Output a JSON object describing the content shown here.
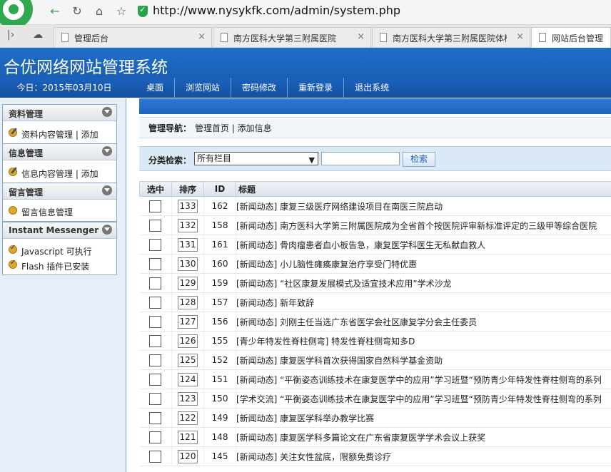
{
  "browser": {
    "url": "http://www.nysykfk.com/admin/system.php",
    "tabs": [
      {
        "label": "管理后台",
        "active": false
      },
      {
        "label": "南方医科大学第三附属医院",
        "active": false
      },
      {
        "label": "南方医科大学第三附属医院体检",
        "active": false
      },
      {
        "label": "网站后台管理",
        "active": true
      }
    ]
  },
  "app": {
    "title": "合优网络网站管理系统",
    "date": "今日：2015年03月10日",
    "menu": [
      "桌面",
      "浏览网站",
      "密码修改",
      "重新登录",
      "退出系统"
    ]
  },
  "sidebar": {
    "panels": [
      {
        "title": "资料管理",
        "items": [
          {
            "label": "资料内容管理 | 添加",
            "icon": "pencil-icon"
          }
        ]
      },
      {
        "title": "信息管理",
        "items": [
          {
            "label": "信息内容管理 | 添加",
            "icon": "pencil-icon"
          }
        ]
      },
      {
        "title": "留言管理",
        "items": [
          {
            "label": "留言信息管理",
            "icon": "message-icon"
          }
        ]
      },
      {
        "title": "Instant Messenger",
        "items": [
          {
            "label": "Javascript 可执行",
            "icon": "check-icon"
          },
          {
            "label": "Flash 插件已安装",
            "icon": "check-icon"
          }
        ]
      }
    ]
  },
  "main": {
    "crumb_label": "管理导航：",
    "crumb_text": "管理首页 | 添加信息",
    "filter_label": "分类检索：",
    "filter_select": "所有栏目",
    "search_button": "检索",
    "columns": [
      "选中",
      "排序",
      "ID",
      "标题"
    ],
    "rows": [
      {
        "order": "133",
        "id": "162",
        "title": "[新闻动态] 康复三级医疗网络建设项目在南医三院启动"
      },
      {
        "order": "132",
        "id": "158",
        "title": "[新闻动态] 南方医科大学第三附属医院成为全省首个按医院评审新标准评定的三级甲等综合医院"
      },
      {
        "order": "131",
        "id": "161",
        "title": "[新闻动态] 骨肉瘤患者血小板告急，康复医学科医生无私献血救人"
      },
      {
        "order": "130",
        "id": "160",
        "title": "[新闻动态] 小儿脑性瘫痪康复治疗享受门特优惠"
      },
      {
        "order": "129",
        "id": "159",
        "title": "[新闻动态] “社区康复发展模式及适宜技术应用”学术沙龙"
      },
      {
        "order": "128",
        "id": "157",
        "title": "[新闻动态] 新年致辞"
      },
      {
        "order": "127",
        "id": "156",
        "title": "[新闻动态] 刘刚主任当选广东省医学会社区康复学分会主任委员"
      },
      {
        "order": "126",
        "id": "155",
        "title": "[青少年特发性脊柱侧弯] 特发性脊柱侧弯知多D"
      },
      {
        "order": "125",
        "id": "152",
        "title": "[新闻动态] 康复医学科首次获得国家自然科学基金资助"
      },
      {
        "order": "124",
        "id": "151",
        "title": "[新闻动态] “平衡姿态训练技术在康复医学中的应用”学习班暨“预防青少年特发性脊柱侧弯的系列"
      },
      {
        "order": "123",
        "id": "150",
        "title": "[学术交流] “平衡姿态训练技术在康复医学中的应用”学习班暨“预防青少年特发性脊柱侧弯的系列"
      },
      {
        "order": "122",
        "id": "149",
        "title": "[新闻动态] 康复医学科举办教学比赛"
      },
      {
        "order": "121",
        "id": "148",
        "title": "[新闻动态] 康复医学科多篇论文在广东省康复医学学术会议上获奖"
      },
      {
        "order": "120",
        "id": "145",
        "title": "[新闻动态] 关注女性盆底，限额免费诊疗"
      }
    ]
  }
}
